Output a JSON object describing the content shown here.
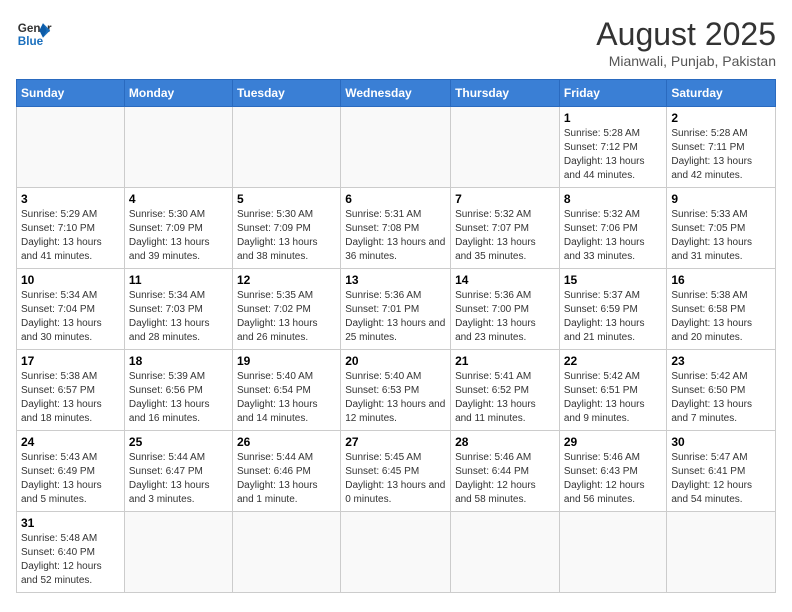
{
  "header": {
    "logo_general": "General",
    "logo_blue": "Blue",
    "title": "August 2025",
    "subtitle": "Mianwali, Punjab, Pakistan"
  },
  "days_of_week": [
    "Sunday",
    "Monday",
    "Tuesday",
    "Wednesday",
    "Thursday",
    "Friday",
    "Saturday"
  ],
  "weeks": [
    [
      {
        "day": "",
        "info": ""
      },
      {
        "day": "",
        "info": ""
      },
      {
        "day": "",
        "info": ""
      },
      {
        "day": "",
        "info": ""
      },
      {
        "day": "",
        "info": ""
      },
      {
        "day": "1",
        "info": "Sunrise: 5:28 AM\nSunset: 7:12 PM\nDaylight: 13 hours and 44 minutes."
      },
      {
        "day": "2",
        "info": "Sunrise: 5:28 AM\nSunset: 7:11 PM\nDaylight: 13 hours and 42 minutes."
      }
    ],
    [
      {
        "day": "3",
        "info": "Sunrise: 5:29 AM\nSunset: 7:10 PM\nDaylight: 13 hours and 41 minutes."
      },
      {
        "day": "4",
        "info": "Sunrise: 5:30 AM\nSunset: 7:09 PM\nDaylight: 13 hours and 39 minutes."
      },
      {
        "day": "5",
        "info": "Sunrise: 5:30 AM\nSunset: 7:09 PM\nDaylight: 13 hours and 38 minutes."
      },
      {
        "day": "6",
        "info": "Sunrise: 5:31 AM\nSunset: 7:08 PM\nDaylight: 13 hours and 36 minutes."
      },
      {
        "day": "7",
        "info": "Sunrise: 5:32 AM\nSunset: 7:07 PM\nDaylight: 13 hours and 35 minutes."
      },
      {
        "day": "8",
        "info": "Sunrise: 5:32 AM\nSunset: 7:06 PM\nDaylight: 13 hours and 33 minutes."
      },
      {
        "day": "9",
        "info": "Sunrise: 5:33 AM\nSunset: 7:05 PM\nDaylight: 13 hours and 31 minutes."
      }
    ],
    [
      {
        "day": "10",
        "info": "Sunrise: 5:34 AM\nSunset: 7:04 PM\nDaylight: 13 hours and 30 minutes."
      },
      {
        "day": "11",
        "info": "Sunrise: 5:34 AM\nSunset: 7:03 PM\nDaylight: 13 hours and 28 minutes."
      },
      {
        "day": "12",
        "info": "Sunrise: 5:35 AM\nSunset: 7:02 PM\nDaylight: 13 hours and 26 minutes."
      },
      {
        "day": "13",
        "info": "Sunrise: 5:36 AM\nSunset: 7:01 PM\nDaylight: 13 hours and 25 minutes."
      },
      {
        "day": "14",
        "info": "Sunrise: 5:36 AM\nSunset: 7:00 PM\nDaylight: 13 hours and 23 minutes."
      },
      {
        "day": "15",
        "info": "Sunrise: 5:37 AM\nSunset: 6:59 PM\nDaylight: 13 hours and 21 minutes."
      },
      {
        "day": "16",
        "info": "Sunrise: 5:38 AM\nSunset: 6:58 PM\nDaylight: 13 hours and 20 minutes."
      }
    ],
    [
      {
        "day": "17",
        "info": "Sunrise: 5:38 AM\nSunset: 6:57 PM\nDaylight: 13 hours and 18 minutes."
      },
      {
        "day": "18",
        "info": "Sunrise: 5:39 AM\nSunset: 6:56 PM\nDaylight: 13 hours and 16 minutes."
      },
      {
        "day": "19",
        "info": "Sunrise: 5:40 AM\nSunset: 6:54 PM\nDaylight: 13 hours and 14 minutes."
      },
      {
        "day": "20",
        "info": "Sunrise: 5:40 AM\nSunset: 6:53 PM\nDaylight: 13 hours and 12 minutes."
      },
      {
        "day": "21",
        "info": "Sunrise: 5:41 AM\nSunset: 6:52 PM\nDaylight: 13 hours and 11 minutes."
      },
      {
        "day": "22",
        "info": "Sunrise: 5:42 AM\nSunset: 6:51 PM\nDaylight: 13 hours and 9 minutes."
      },
      {
        "day": "23",
        "info": "Sunrise: 5:42 AM\nSunset: 6:50 PM\nDaylight: 13 hours and 7 minutes."
      }
    ],
    [
      {
        "day": "24",
        "info": "Sunrise: 5:43 AM\nSunset: 6:49 PM\nDaylight: 13 hours and 5 minutes."
      },
      {
        "day": "25",
        "info": "Sunrise: 5:44 AM\nSunset: 6:47 PM\nDaylight: 13 hours and 3 minutes."
      },
      {
        "day": "26",
        "info": "Sunrise: 5:44 AM\nSunset: 6:46 PM\nDaylight: 13 hours and 1 minute."
      },
      {
        "day": "27",
        "info": "Sunrise: 5:45 AM\nSunset: 6:45 PM\nDaylight: 13 hours and 0 minutes."
      },
      {
        "day": "28",
        "info": "Sunrise: 5:46 AM\nSunset: 6:44 PM\nDaylight: 12 hours and 58 minutes."
      },
      {
        "day": "29",
        "info": "Sunrise: 5:46 AM\nSunset: 6:43 PM\nDaylight: 12 hours and 56 minutes."
      },
      {
        "day": "30",
        "info": "Sunrise: 5:47 AM\nSunset: 6:41 PM\nDaylight: 12 hours and 54 minutes."
      }
    ],
    [
      {
        "day": "31",
        "info": "Sunrise: 5:48 AM\nSunset: 6:40 PM\nDaylight: 12 hours and 52 minutes."
      },
      {
        "day": "",
        "info": ""
      },
      {
        "day": "",
        "info": ""
      },
      {
        "day": "",
        "info": ""
      },
      {
        "day": "",
        "info": ""
      },
      {
        "day": "",
        "info": ""
      },
      {
        "day": "",
        "info": ""
      }
    ]
  ]
}
